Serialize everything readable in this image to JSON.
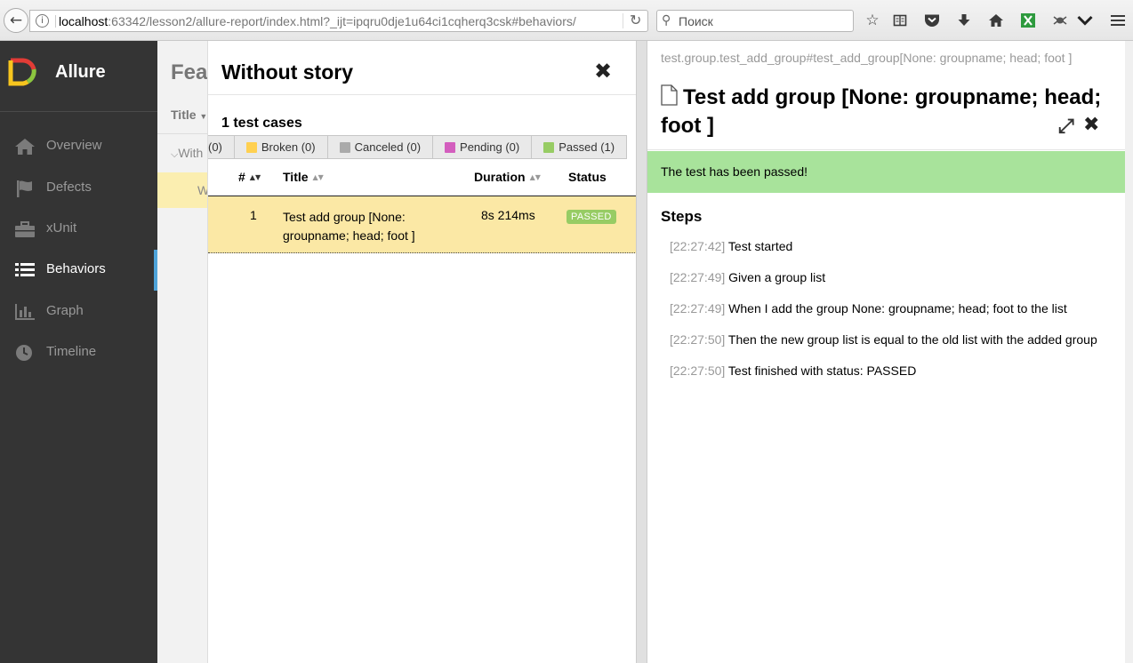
{
  "browser": {
    "url_host": "localhost",
    "url_rest": ":63342/lesson2/allure-report/index.html?_ijt=ipqru0dje1u64ci1cqherq3csk#behaviors/",
    "search_placeholder": "Поиск"
  },
  "sidebar": {
    "brand": "Allure",
    "items": [
      {
        "label": "Overview",
        "icon": "home-icon"
      },
      {
        "label": "Defects",
        "icon": "flag-icon"
      },
      {
        "label": "xUnit",
        "icon": "briefcase-icon"
      },
      {
        "label": "Behaviors",
        "icon": "list-icon",
        "active": true
      },
      {
        "label": "Graph",
        "icon": "bar-chart-icon"
      },
      {
        "label": "Timeline",
        "icon": "clock-icon"
      }
    ]
  },
  "behaviors": {
    "title": "Fea",
    "column_title": "Title",
    "group": "With",
    "row": "W"
  },
  "story": {
    "title": "Without story",
    "count_label": "1 test cases",
    "filters": [
      {
        "label": "(0)",
        "color": ""
      },
      {
        "label": "Broken (0)",
        "color": "#ffd050"
      },
      {
        "label": "Canceled (0)",
        "color": "#aaaaaa"
      },
      {
        "label": "Pending (0)",
        "color": "#d35ebe"
      },
      {
        "label": "Passed (1)",
        "color": "#97cc64"
      }
    ],
    "columns": {
      "num": "#",
      "title": "Title",
      "duration": "Duration",
      "status": "Status"
    },
    "rows": [
      {
        "num": "1",
        "title": "Test add group [None: groupname; head; foot ]",
        "duration": "8s 214ms",
        "status": "PASSED"
      }
    ]
  },
  "testcase": {
    "full_name": "test.group.test_add_group#test_add_group[None: groupname; head; foot ]",
    "title": "Test add group [None: groupname; head; foot ]",
    "status_message": "The test has been passed!",
    "steps_heading": "Steps",
    "steps": [
      {
        "time": "[22:27:42]",
        "text": "Test started"
      },
      {
        "time": "[22:27:49]",
        "text": "Given a group list"
      },
      {
        "time": "[22:27:49]",
        "text": "When I add the group None: groupname; head; foot to the list"
      },
      {
        "time": "[22:27:50]",
        "text": "Then the new group list is equal to the old list with the added group"
      },
      {
        "time": "[22:27:50]",
        "text": "Test finished with status: PASSED"
      }
    ]
  }
}
